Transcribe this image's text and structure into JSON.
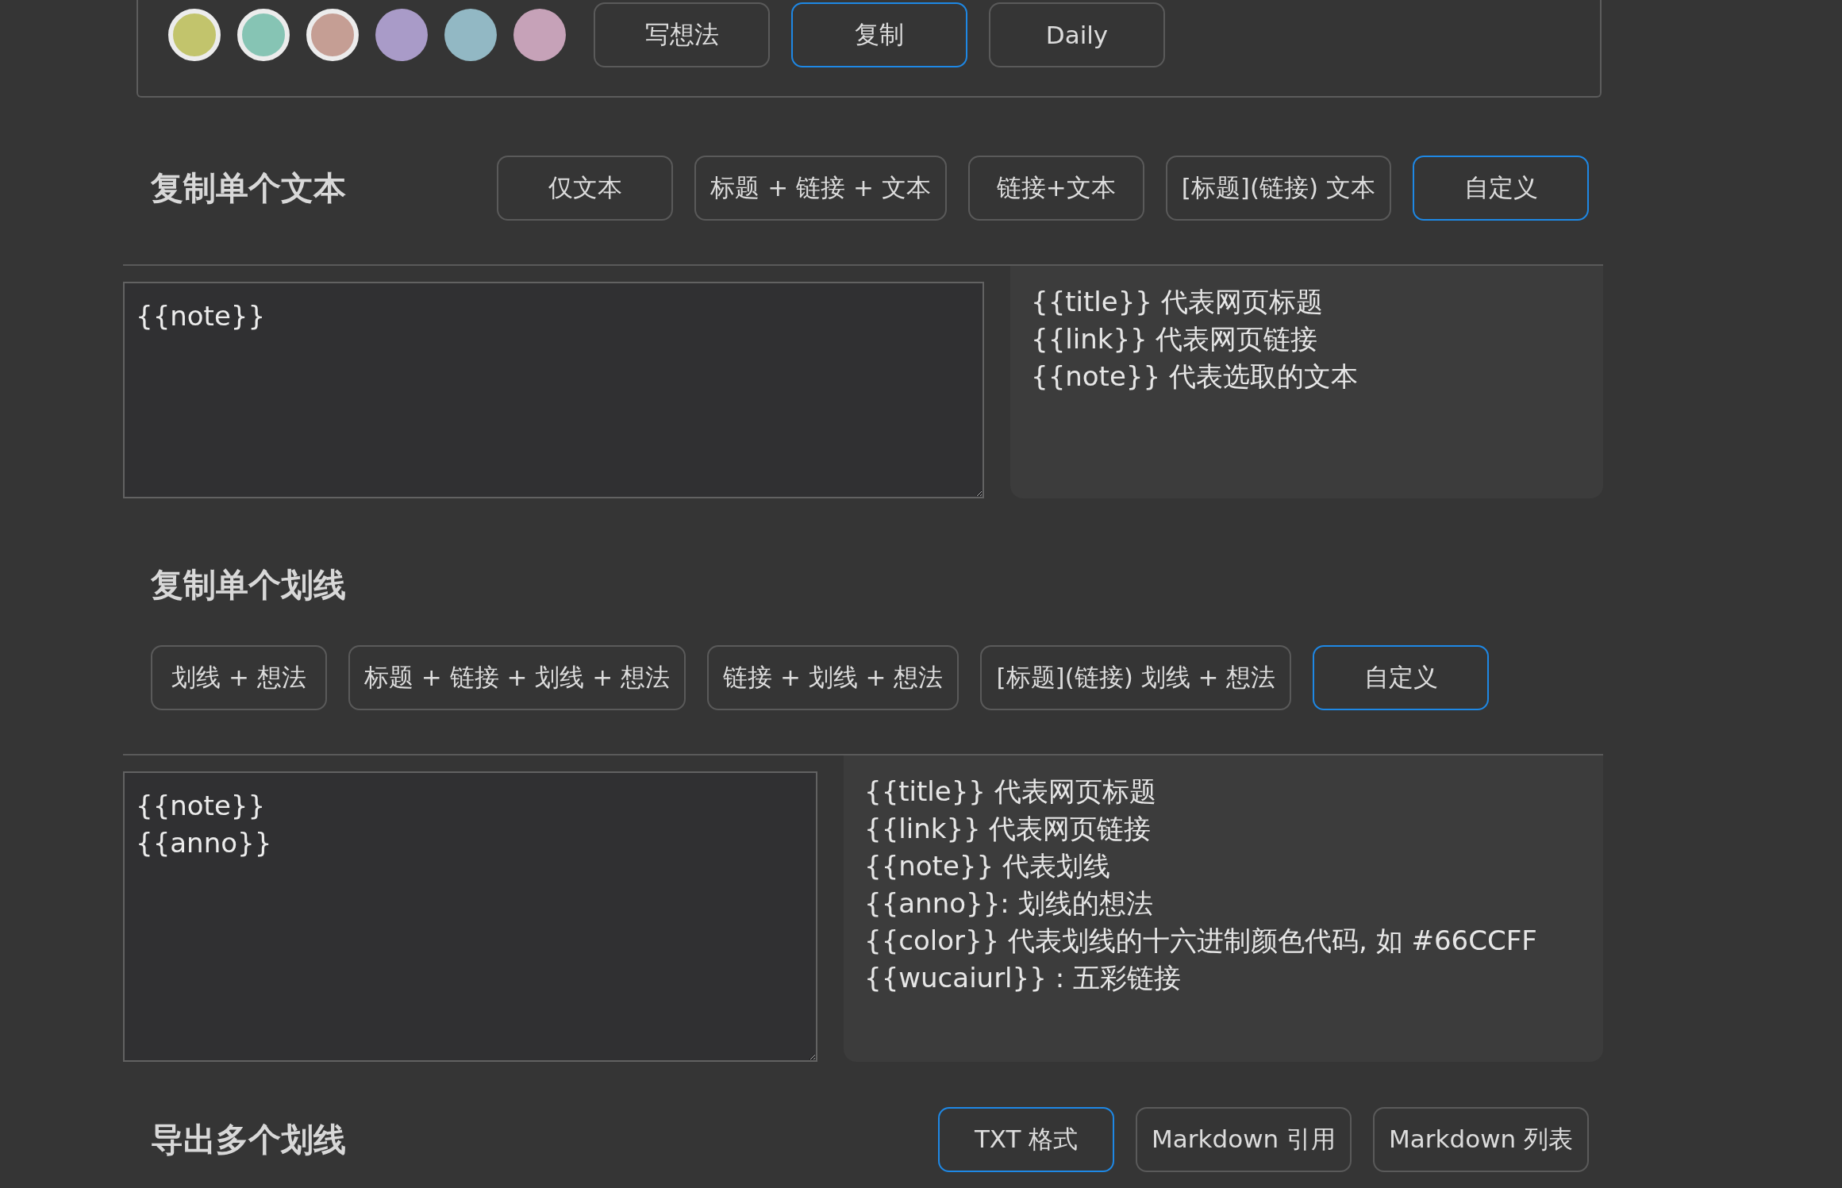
{
  "top_bar": {
    "colors": [
      {
        "color": "#c2c46c",
        "selected": true
      },
      {
        "color": "#86c4b4",
        "selected": true
      },
      {
        "color": "#c59e94",
        "selected": true
      },
      {
        "color": "#a99bc8",
        "selected": false
      },
      {
        "color": "#92b8c4",
        "selected": false
      },
      {
        "color": "#c6a2b8",
        "selected": false
      }
    ],
    "modes": [
      {
        "label": "写想法",
        "selected": false
      },
      {
        "label": "复制",
        "selected": true
      },
      {
        "label": "Daily",
        "selected": false
      }
    ]
  },
  "sections": [
    {
      "kind": "inline",
      "title": "复制单个文本",
      "presets": [
        {
          "label": "仅文本",
          "selected": false
        },
        {
          "label": "标题 + 链接 + 文本",
          "selected": false
        },
        {
          "label": "链接+文本",
          "selected": false
        },
        {
          "label": "[标题](链接) 文本",
          "selected": false
        },
        {
          "label": "自定义",
          "selected": true
        }
      ],
      "template": {
        "value": "{{note}}"
      },
      "help": [
        "{{title}} 代表网页标题",
        "{{link}} 代表网页链接",
        "{{note}} 代表选取的文本"
      ]
    },
    {
      "kind": "stacked",
      "title": "复制单个划线",
      "presets": [
        {
          "label": "划线 + 想法",
          "selected": false
        },
        {
          "label": "标题 + 链接 + 划线 + 想法",
          "selected": false
        },
        {
          "label": "链接 + 划线 + 想法",
          "selected": false
        },
        {
          "label": "[标题](链接) 划线 + 想法",
          "selected": false
        },
        {
          "label": "自定义",
          "selected": true
        }
      ],
      "template": {
        "value": "{{note}}\n{{anno}}"
      },
      "help": [
        "{{title}} 代表网页标题",
        "{{link}} 代表网页链接",
        "{{note}} 代表划线",
        "{{anno}}: 划线的想法",
        "{{color}} 代表划线的十六进制颜色代码, 如 #66CCFF",
        "{{wucaiurl}} : 五彩链接"
      ]
    },
    {
      "kind": "inline-end",
      "title": "导出多个划线",
      "presets": [
        {
          "label": "TXT 格式",
          "selected": true
        },
        {
          "label": "Markdown 引用",
          "selected": false
        },
        {
          "label": "Markdown 列表",
          "selected": false
        }
      ]
    }
  ]
}
